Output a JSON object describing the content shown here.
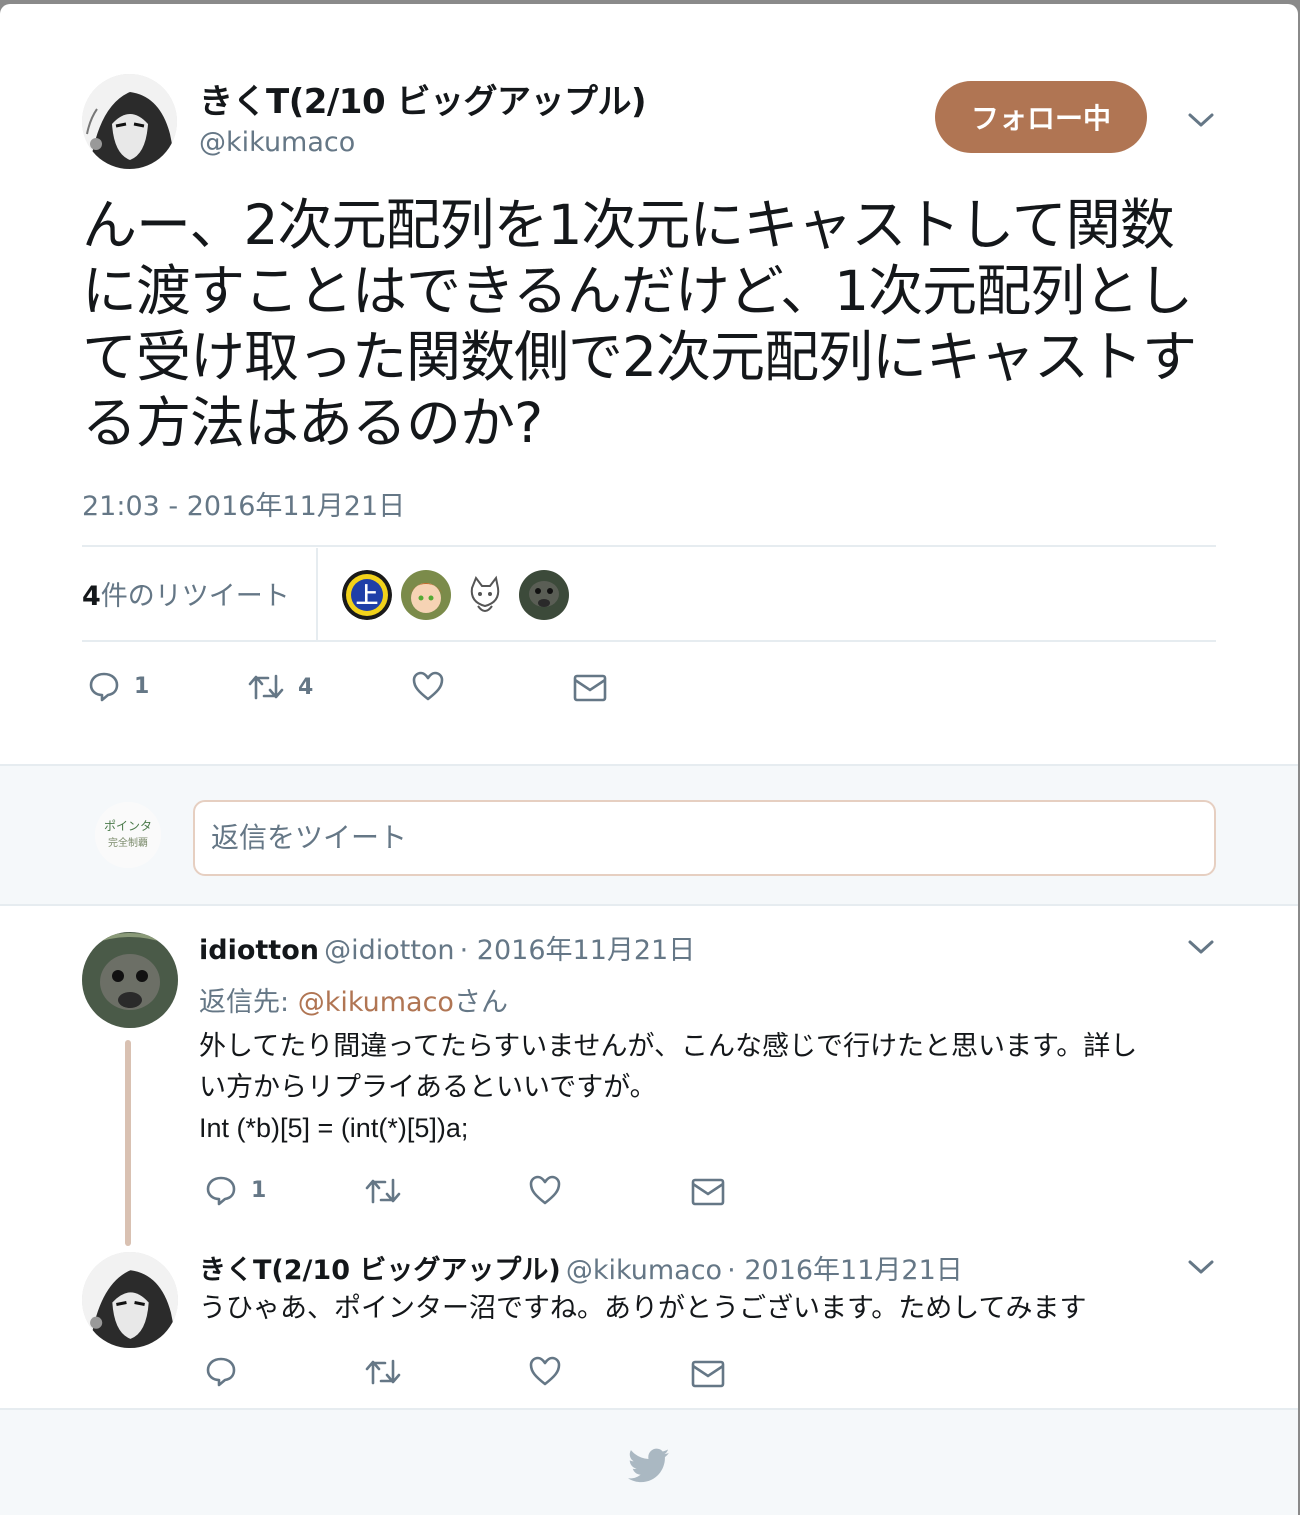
{
  "tweet": {
    "author_name": "きくT(2/10 ビッグアップル)",
    "author_handle": "@kikumaco",
    "follow_label": "フォロー中",
    "text": "んー、2次元配列を1次元にキャストして関数に渡すことはできるんだけど、1次元配列として受け取った関数側で2次元配列にキャストする方法はあるのか?",
    "timestamp": "21:03 - 2016年11月21日",
    "retweet_count_num": "4",
    "retweet_count_suffix": "件のリツイート",
    "actions": {
      "reply_count": "1",
      "retweet_count": "4"
    }
  },
  "reply_box": {
    "placeholder": "返信をツイート"
  },
  "replies": [
    {
      "name": "idiotton",
      "handle": "@idiotton",
      "date": "· 2016年11月21日",
      "reply_to_prefix": "返信先: ",
      "reply_to_handle": "@kikumaco",
      "reply_to_suffix": "さん",
      "text_line1": "外してたり間違ってたらすいませんが、こんな感じで行けたと思います。詳し",
      "text_line2": "い方からリプライあるといいですが。",
      "text_line3": "Int (*b)[5] = (int(*)[5])a;",
      "reply_count": "1"
    },
    {
      "name": "きくT(2/10 ビッグアップル)",
      "handle": "@kikumaco",
      "date": "· 2016年11月21日",
      "text": "うひゃあ、ポインター沼ですね。ありがとうございます。ためしてみます"
    }
  ],
  "colors": {
    "accent": "#b07553",
    "muted": "#657786",
    "text": "#14171a",
    "thread": "#d9c1b2"
  },
  "icons": [
    "reply-icon",
    "retweet-icon",
    "like-icon",
    "dm-icon",
    "chevron-down-icon",
    "twitter-bird-icon"
  ]
}
